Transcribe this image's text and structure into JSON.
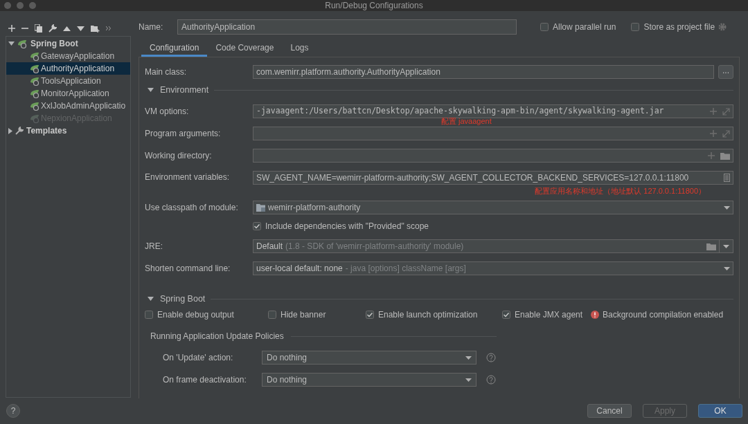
{
  "window": {
    "title": "Run/Debug Configurations"
  },
  "tree": [
    {
      "label": "Spring Boot",
      "kind": "group",
      "expanded": true,
      "children": [
        {
          "label": "GatewayApplication",
          "selected": false,
          "disabled": false
        },
        {
          "label": "AuthorityApplication",
          "selected": true,
          "disabled": false
        },
        {
          "label": "ToolsApplication",
          "selected": false,
          "disabled": false
        },
        {
          "label": "MonitorApplication",
          "selected": false,
          "disabled": false
        },
        {
          "label": "XxlJobAdminApplicatio",
          "selected": false,
          "disabled": false
        },
        {
          "label": "NepxionApplication",
          "selected": false,
          "disabled": true
        }
      ]
    },
    {
      "label": "Templates",
      "kind": "templates",
      "expanded": false
    }
  ],
  "name_field": {
    "label": "Name:",
    "value": "AuthorityApplication"
  },
  "header_options": [
    {
      "label": "Allow parallel run",
      "checked": false
    },
    {
      "label": "Store as project file",
      "checked": false
    }
  ],
  "tabs": [
    {
      "label": "Configuration",
      "selected": true
    },
    {
      "label": "Code Coverage",
      "selected": false
    },
    {
      "label": "Logs",
      "selected": false
    }
  ],
  "main_class": {
    "label": "Main class:",
    "value": "com.wemirr.platform.authority.AuthorityApplication",
    "button": "..."
  },
  "environment": {
    "title": "Environment",
    "expanded": true,
    "fields": [
      {
        "kind": "text",
        "label": "VM options:",
        "value": "-javaagent:/Users/battcn/Desktop/apache-skywalking-apm-bin/agent/skywalking-agent.jar",
        "note": "配置 javaagent"
      },
      {
        "kind": "text",
        "label": "Program arguments:"
      },
      {
        "kind": "folder",
        "label": "Working directory:"
      },
      {
        "kind": "env",
        "label": "Environment variables:",
        "value": "SW_AGENT_NAME=wemirr-platform-authority;SW_AGENT_COLLECTOR_BACKEND_SERVICES=127.0.0.1:11800",
        "note": "配置应用名称和地址（地址默认 127.0.0.1:11800）"
      },
      {
        "kind": "module",
        "label": "Use classpath of module:",
        "value": "wemirr-platform-authority"
      },
      {
        "kind": "checkbox",
        "label": "Include dependencies with \"Provided\" scope",
        "checked": true
      },
      {
        "kind": "jre",
        "label": "JRE:",
        "value": "Default",
        "hint": "(1.8 - SDK of 'wemirr-platform-authority' module)"
      },
      {
        "kind": "select",
        "label": "Shorten command line:",
        "value": "user-local default: none",
        "hint": "- java [options] className [args]"
      }
    ]
  },
  "spring_boot": {
    "title": "Spring Boot",
    "expanded": true,
    "options": [
      {
        "label": "Enable debug output",
        "checked": false
      },
      {
        "label": "Hide banner",
        "checked": false
      },
      {
        "label": "Enable launch optimization",
        "checked": true
      },
      {
        "label": "Enable JMX agent",
        "checked": true
      }
    ],
    "warning": "Background compilation enabled"
  },
  "update_policies": {
    "title": "Running Application Update Policies",
    "fields": [
      {
        "label": "On 'Update' action:",
        "value": "Do nothing"
      },
      {
        "label": "On frame deactivation:",
        "value": "Do nothing"
      }
    ]
  },
  "help": "?",
  "buttons": [
    {
      "label": "Cancel",
      "kind": "normal",
      "disabled": false
    },
    {
      "label": "Apply",
      "kind": "normal",
      "disabled": true
    },
    {
      "label": "OK",
      "kind": "default",
      "disabled": false
    }
  ]
}
